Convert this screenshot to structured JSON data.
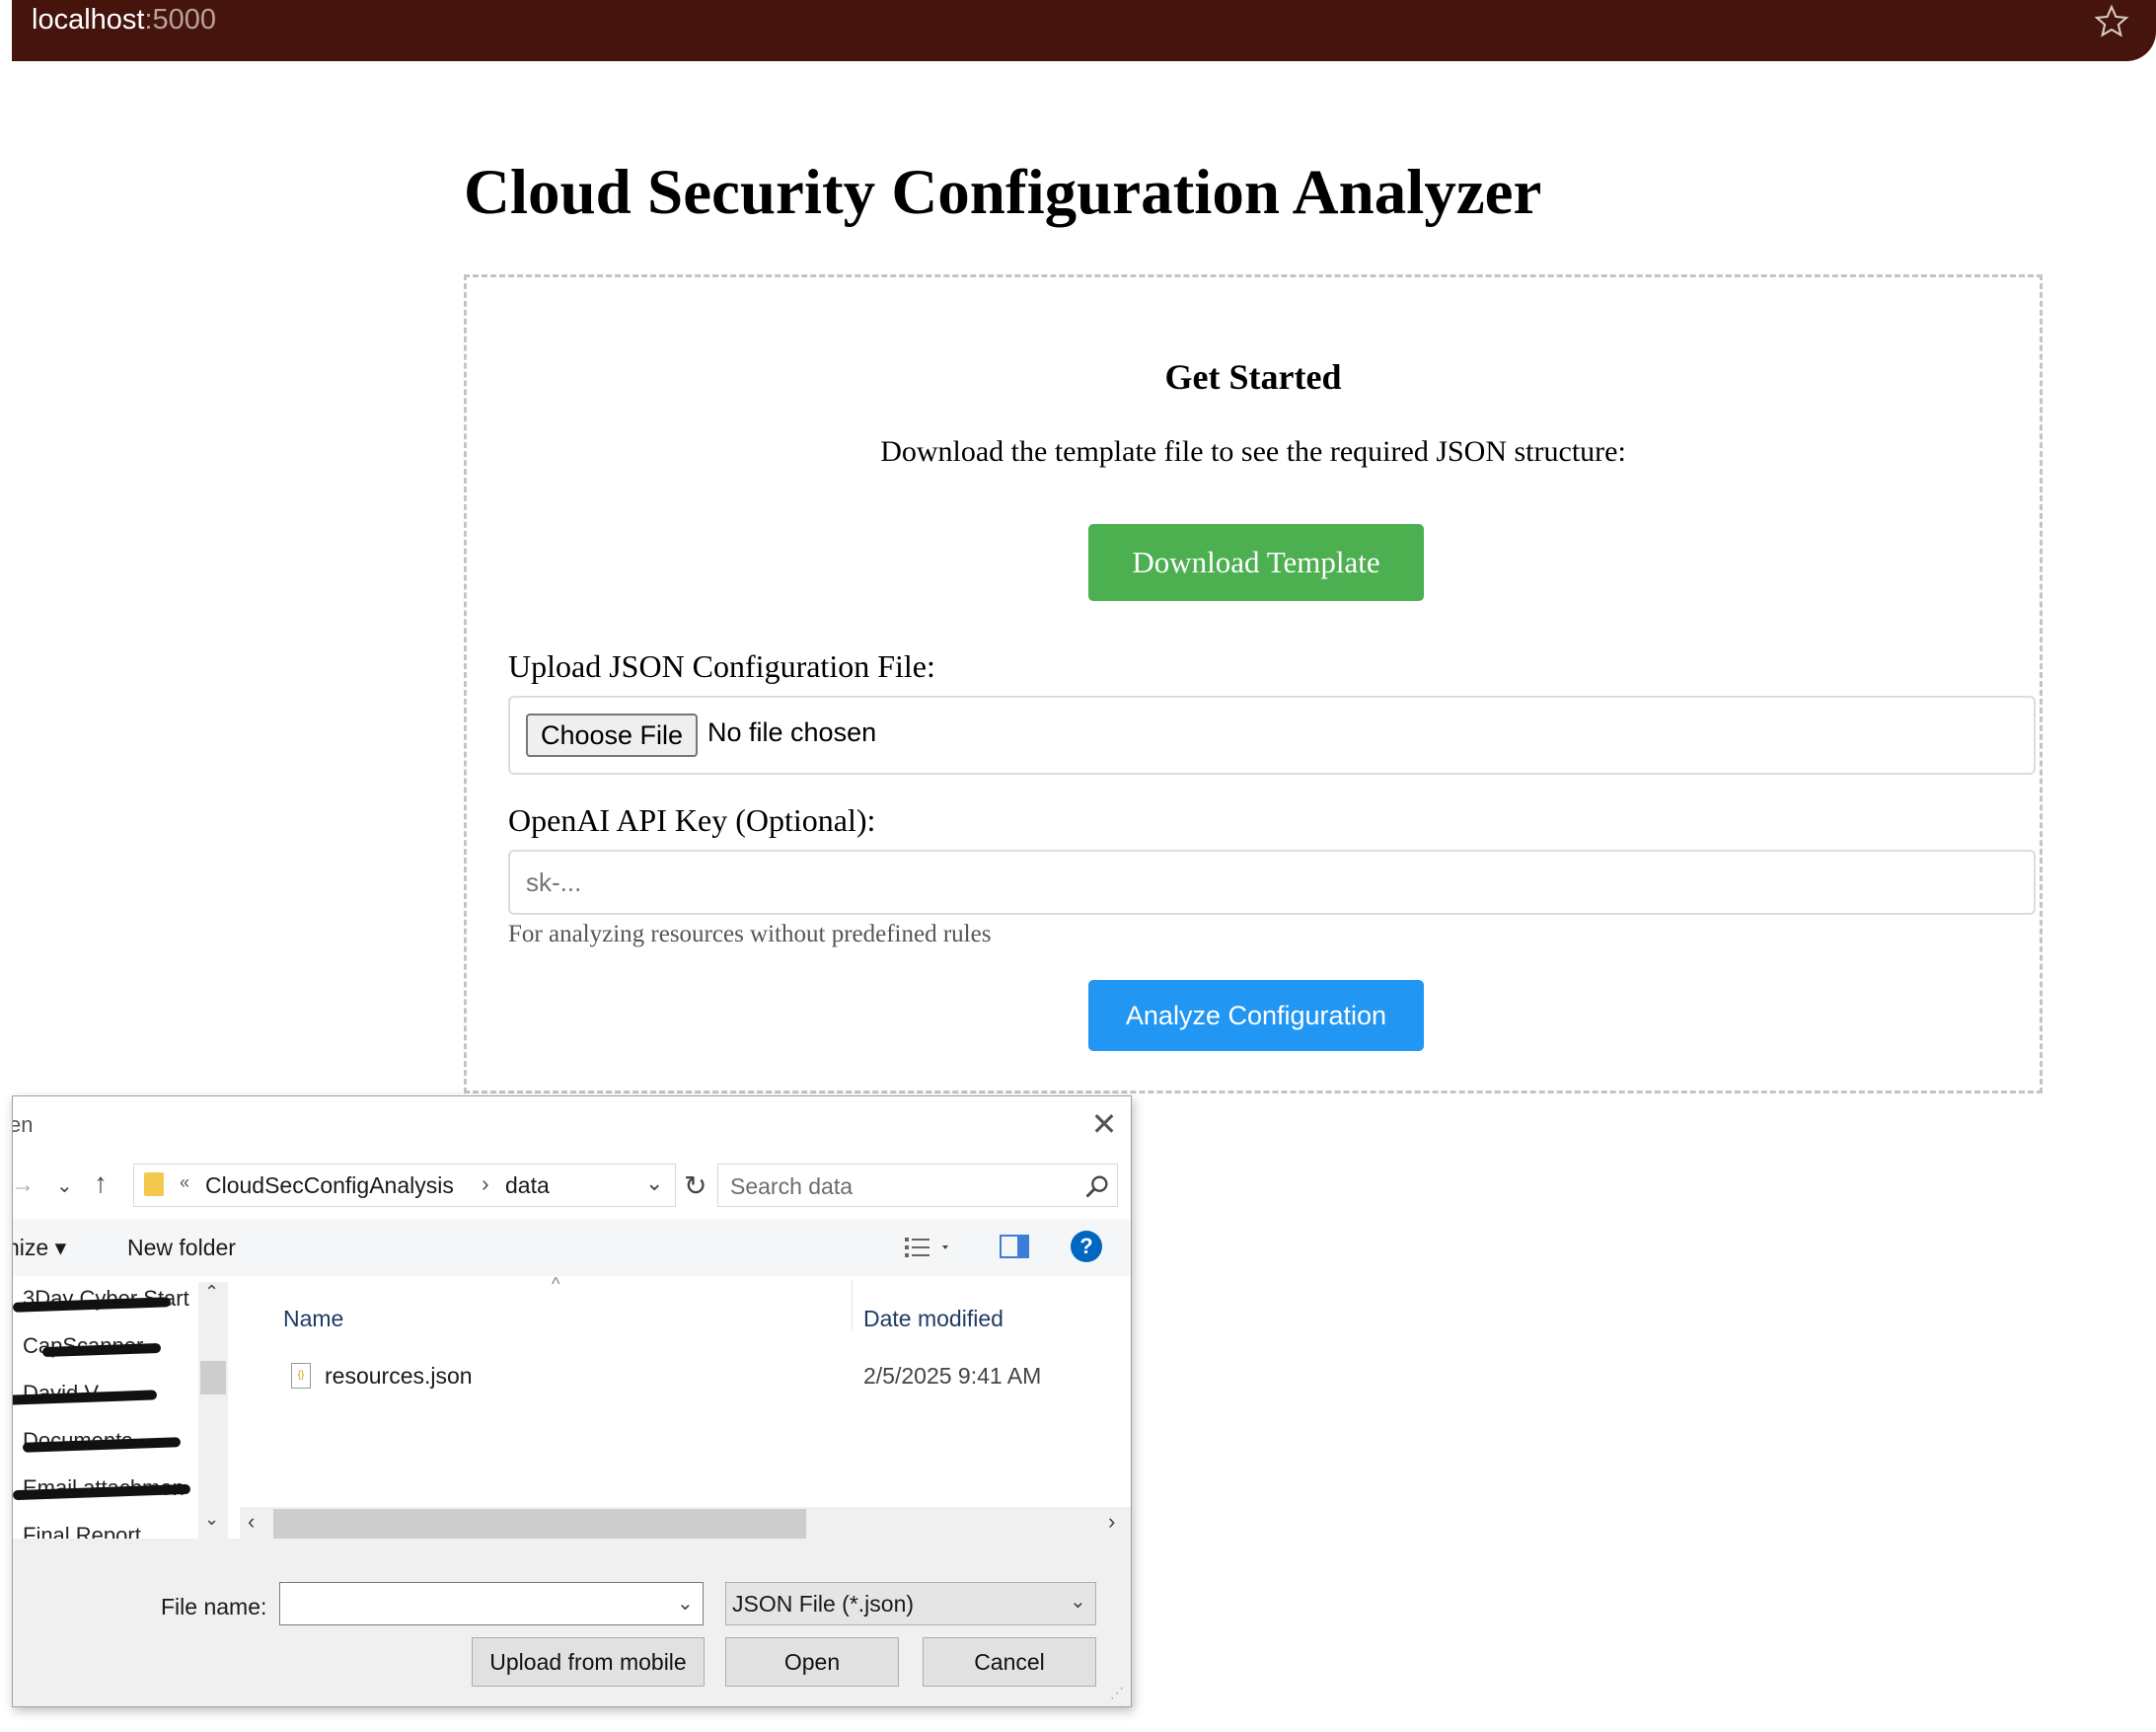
{
  "browser": {
    "host": "localhost",
    "port": ":5000",
    "icons": {
      "bookmark": "star-icon"
    }
  },
  "page": {
    "title": "Cloud Security Configuration Analyzer",
    "get_started": {
      "heading": "Get Started",
      "description": "Download the template file to see the required JSON structure:",
      "download_button": "Download Template"
    },
    "upload": {
      "label": "Upload JSON Configuration File:",
      "choose_button": "Choose File",
      "status": "No file chosen"
    },
    "api_key": {
      "label": "OpenAI API Key (Optional):",
      "placeholder": "sk-...",
      "value": "",
      "help": "For analyzing resources without predefined rules"
    },
    "analyze_button": "Analyze Configuration",
    "colors": {
      "download": "#4caf50",
      "analyze": "#2196f3",
      "browser_bar": "#45140c"
    }
  },
  "dialog": {
    "title": "en",
    "close": "✕",
    "path": [
      "CloudSecConfigAnalysis",
      "data"
    ],
    "path_prefix": "«",
    "search_placeholder": "Search data",
    "organize": "nize ▾",
    "new_folder": "New folder",
    "nav_items": [
      "3Day Cyber Start",
      "CapScanner",
      "David V",
      "Documents",
      "Email attachmen",
      "Final Report"
    ],
    "columns": {
      "name": "Name",
      "date": "Date modified"
    },
    "files": [
      {
        "name": "resources.json",
        "date": "2/5/2025 9:41 AM",
        "icon": "json-file-icon"
      }
    ],
    "file_name_label": "File name:",
    "file_name_value": "",
    "file_type": "JSON File (*.json)",
    "buttons": {
      "upload_mobile": "Upload from mobile",
      "open": "Open",
      "cancel": "Cancel"
    }
  }
}
